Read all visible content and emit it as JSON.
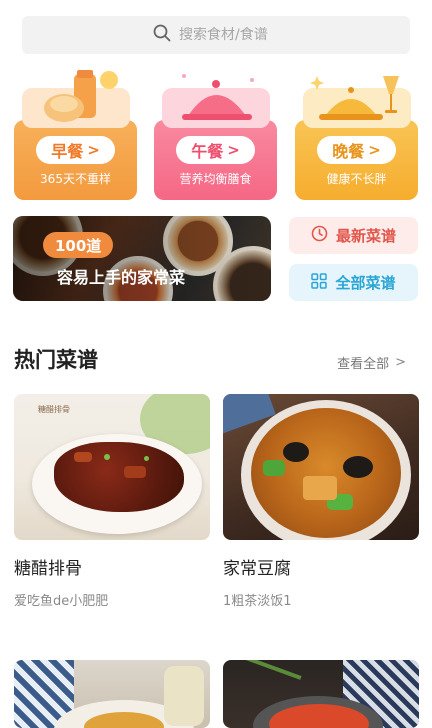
{
  "search": {
    "placeholder": "搜索食材/食谱"
  },
  "meals": [
    {
      "label": "早餐",
      "subtitle": "365天不重样",
      "color": "#f5a14a",
      "text_color": "#f07a2a"
    },
    {
      "label": "午餐",
      "subtitle": "营养均衡膳食",
      "color": "#f56d86",
      "text_color": "#ef4f6e"
    },
    {
      "label": "晚餐",
      "subtitle": "健康不长胖",
      "color": "#f6b93c",
      "text_color": "#e8941c"
    }
  ],
  "banner": {
    "badge": "100道",
    "title": "容易上手的家常菜"
  },
  "quick_links": {
    "latest": "最新菜谱",
    "all": "全部菜谱"
  },
  "section": {
    "title": "热门菜谱",
    "see_all": "查看全部"
  },
  "recipes": [
    {
      "name": "糖醋排骨",
      "author": "爱吃鱼de小肥肥",
      "photo_text": "糖醋排骨"
    },
    {
      "name": "家常豆腐",
      "author": "1粗茶淡饭1"
    }
  ],
  "icons": {
    "search": "search-icon",
    "clock": "clock-icon",
    "grid": "grid-icon",
    "chevron": "chevron-right-icon"
  },
  "colors": {
    "latest_bg": "#fdecea",
    "latest_text": "#e2574c",
    "all_bg": "#e6f5fb",
    "all_text": "#2aa6d6"
  }
}
